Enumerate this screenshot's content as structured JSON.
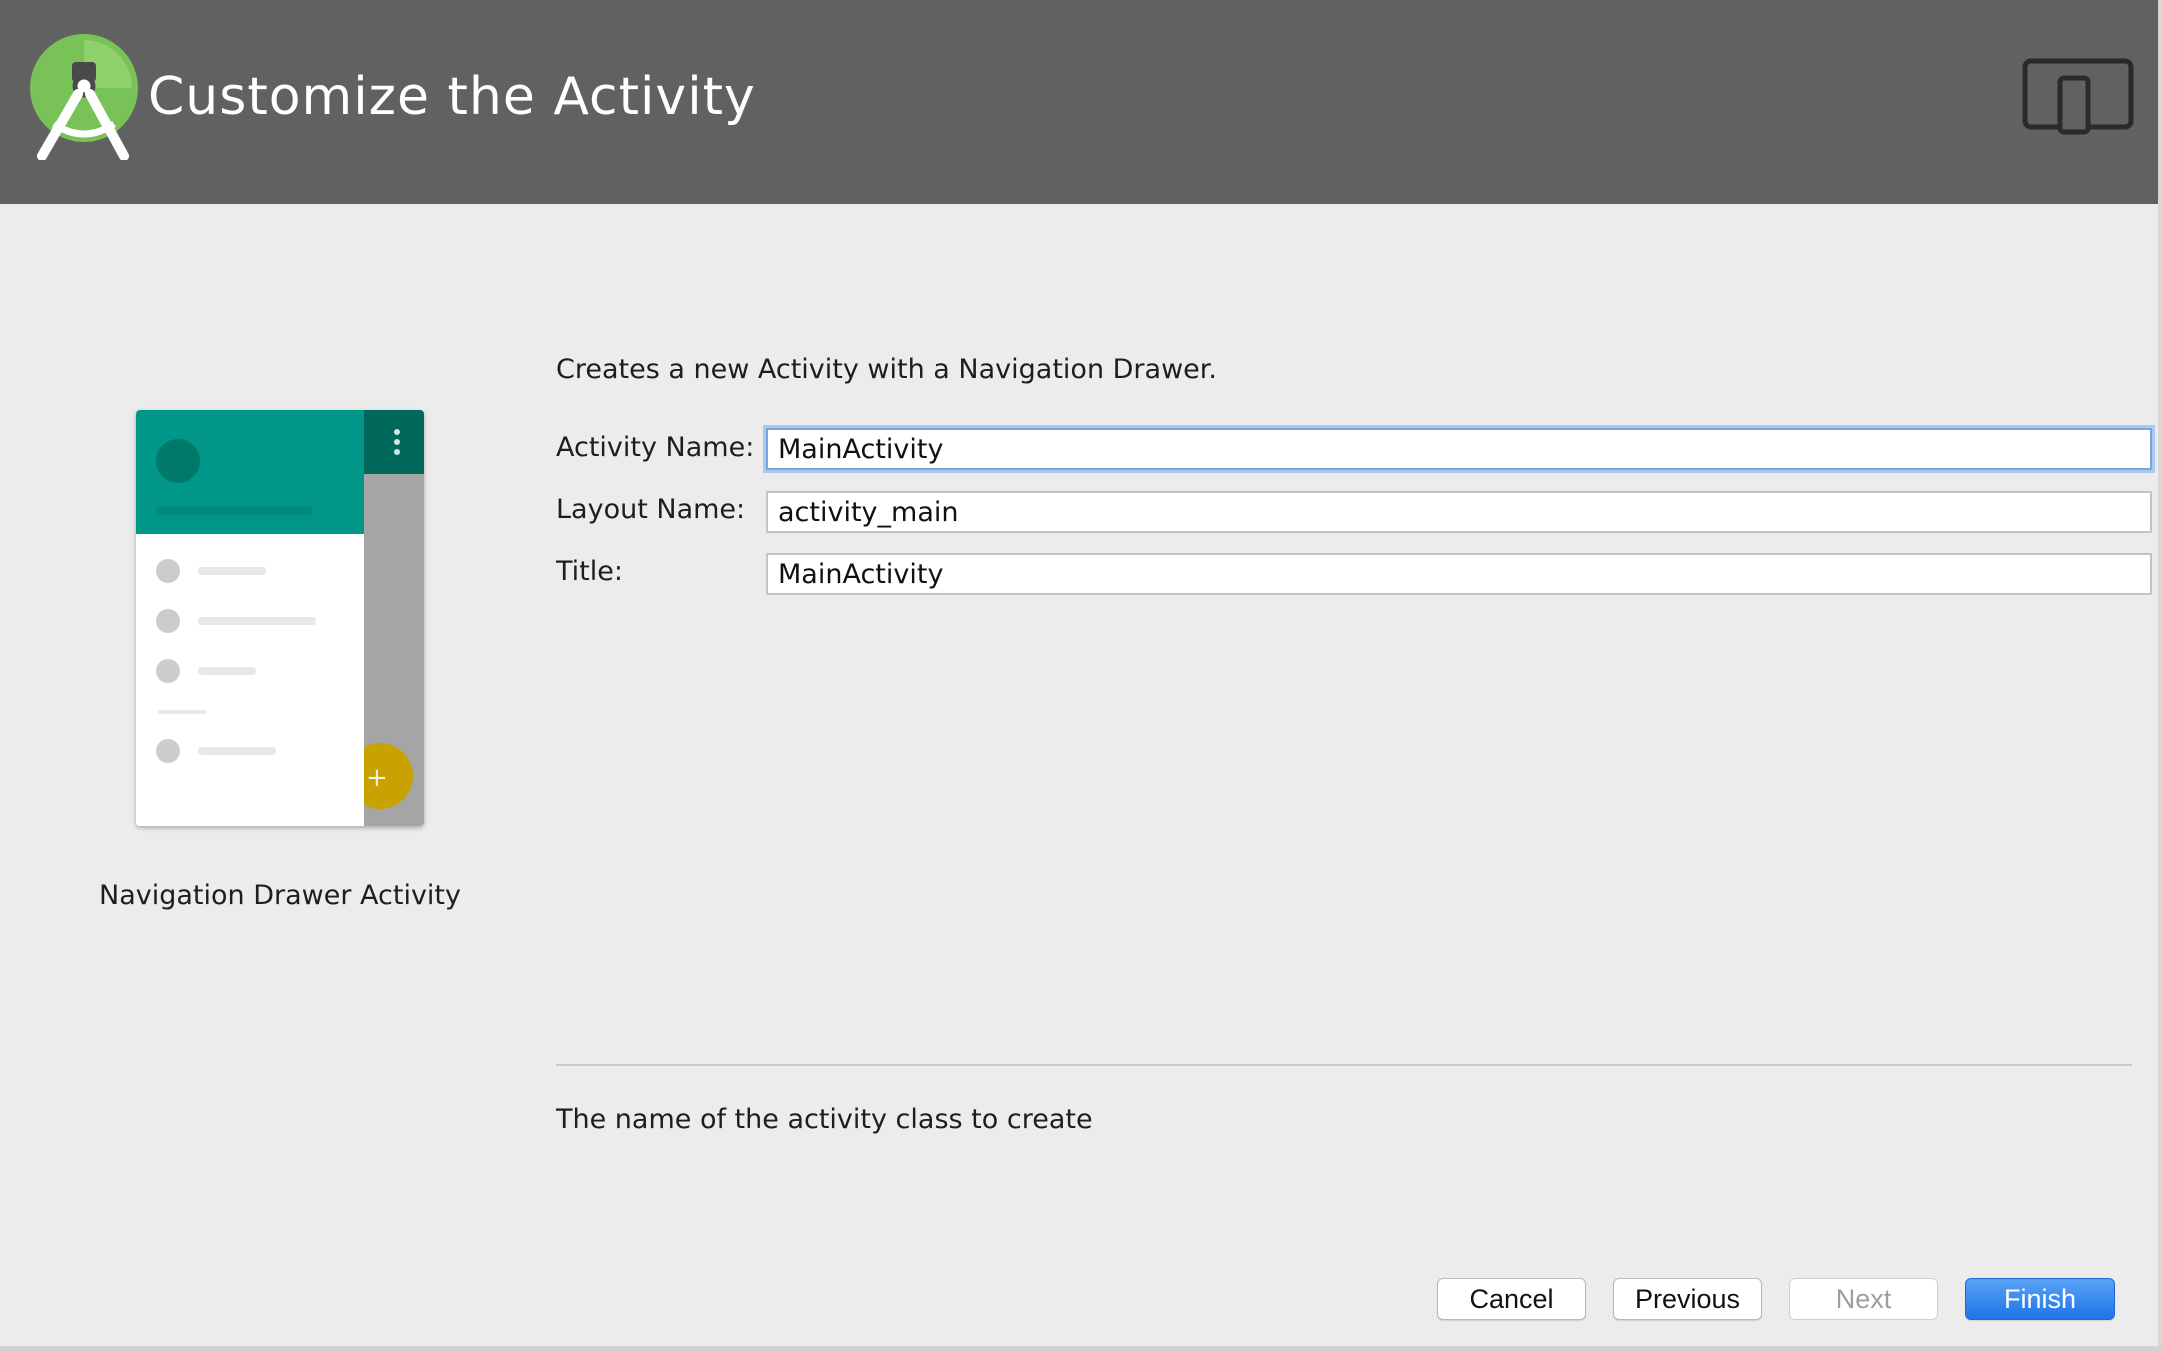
{
  "header": {
    "title": "Customize the Activity",
    "logo_icon": "android-studio-logo-icon",
    "device_icon": "tablet-phone-icon",
    "background": "#616161"
  },
  "preview": {
    "caption": "Navigation Drawer Activity",
    "fab_symbol": "+",
    "accent_color": "#009688",
    "fab_color": "#c8a200"
  },
  "form": {
    "description": "Creates a new Activity with a Navigation Drawer.",
    "fields": [
      {
        "label": "Activity Name:",
        "value": "MainActivity",
        "focused": true
      },
      {
        "label": "Layout Name:",
        "value": "activity_main",
        "focused": false
      },
      {
        "label": "Title:",
        "value": "MainActivity",
        "focused": false
      }
    ],
    "help_text": "The name of the activity class to create"
  },
  "buttons": {
    "cancel": "Cancel",
    "previous": "Previous",
    "next": "Next",
    "finish": "Finish",
    "next_enabled": false
  }
}
